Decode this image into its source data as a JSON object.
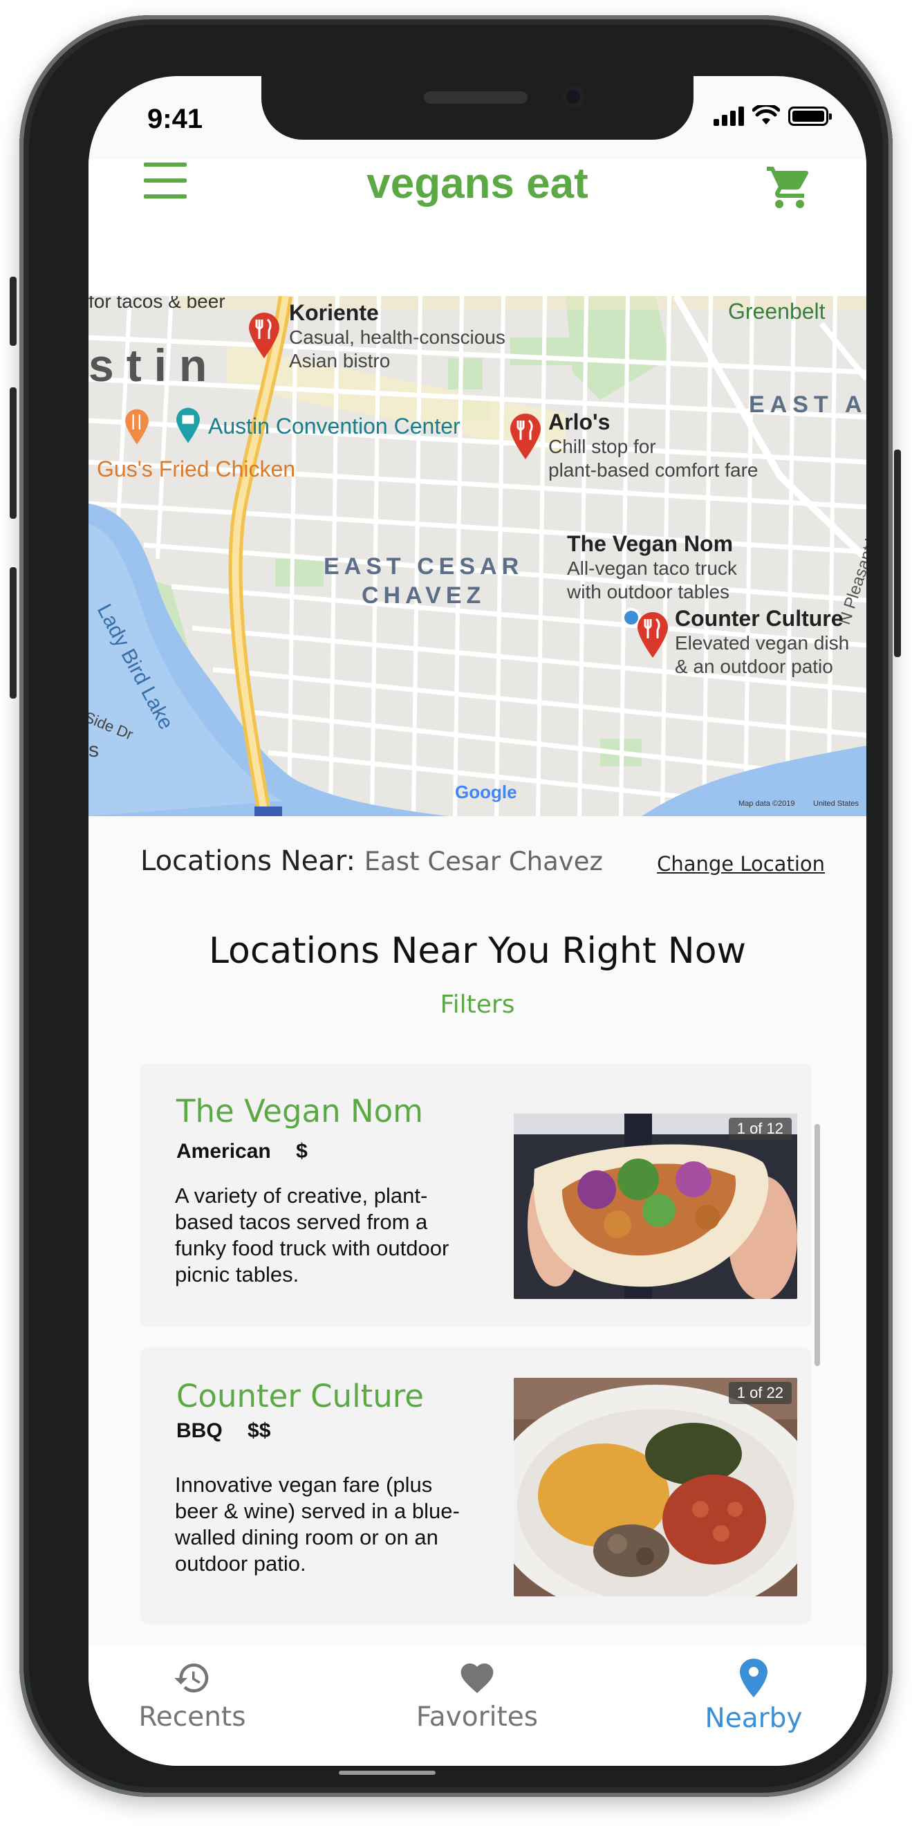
{
  "status_bar": {
    "time": "9:41"
  },
  "header": {
    "app_title": "vegans eat"
  },
  "map": {
    "labels": {
      "tacos_beer": "for tacos & beer",
      "austin": "stin",
      "greenbelt": "Greenbelt",
      "east_austin": "EAST A",
      "convention_center": "Austin Convention Center",
      "gus": "Gus's Fried Chicken",
      "district_1": "EAST CESAR",
      "district_2": "CHAVEZ",
      "lady_bird_lake": "Lady Bird Lake",
      "n_pleasant": "N Pleasant Valley",
      "side_dr": "Side Dr",
      "s": "s",
      "google": "Google",
      "map_data": "Map data ©2019",
      "united_states": "United States"
    },
    "places": [
      {
        "name": "Koriente",
        "desc_1": "Casual, health-conscious",
        "desc_2": "Asian bistro"
      },
      {
        "name": "Arlo's",
        "desc_1": "Chill stop for",
        "desc_2": "plant-based comfort fare"
      },
      {
        "name": "The Vegan Nom",
        "desc_1": "All-vegan taco truck",
        "desc_2": "with outdoor tables"
      },
      {
        "name": "Counter Culture",
        "desc_1": "Elevated vegan dish",
        "desc_2": "& an outdoor patio"
      }
    ]
  },
  "location": {
    "label": "Locations Near:",
    "value": "East Cesar Chavez",
    "change_label": "Change Location"
  },
  "section": {
    "title": "Locations Near You Right Now",
    "filters_label": "Filters"
  },
  "restaurants": [
    {
      "name": "The Vegan Nom",
      "cuisine": "American",
      "price": "$",
      "description": "A variety of creative, plant-based tacos served from a funky food truck with outdoor picnic tables.",
      "photo_count": "1 of 12"
    },
    {
      "name": "Counter Culture",
      "cuisine": "BBQ",
      "price": "$$",
      "description": "Innovative vegan fare (plus beer & wine) served in a blue-walled dining room or on an outdoor patio.",
      "photo_count": "1 of 22"
    }
  ],
  "bottom_nav": {
    "items": [
      {
        "label": "Recents",
        "icon": "history-icon",
        "active": false
      },
      {
        "label": "Favorites",
        "icon": "heart-icon",
        "active": false
      },
      {
        "label": "Nearby",
        "icon": "location-pin-icon",
        "active": true
      }
    ]
  },
  "colors": {
    "brand_green": "#5aa944",
    "active_blue": "#3b8fd6",
    "inactive_gray": "#757575",
    "map_pin_red": "#d9392a"
  }
}
